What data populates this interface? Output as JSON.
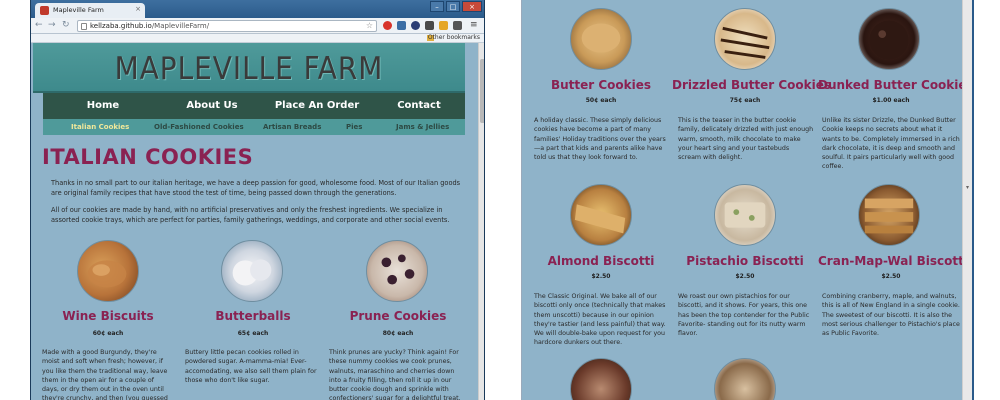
{
  "browser": {
    "tab_title": "Mapleville Farm",
    "url_host": "kellzaba.github.io",
    "url_path": "/MaplevilleFarm/",
    "bookmarks_label": "Other bookmarks"
  },
  "site": {
    "title": "MAPLEVILLE FARM",
    "nav": [
      "Home",
      "About Us",
      "Place An Order",
      "Contact"
    ],
    "subnav": [
      "Italian Cookies",
      "Old-Fashioned Cookies",
      "Artisan Breads",
      "Pies",
      "Jams & Jellies"
    ],
    "active_subnav": "Italian Cookies",
    "colors": {
      "page_bg": "#8fb3c9",
      "header": "#4f9a9a",
      "nav": "#2f5448",
      "accent": "#8a2252",
      "active_link": "#f0e89a"
    }
  },
  "page": {
    "heading": "ITALIAN COOKIES",
    "intro1": "Thanks in no small part to our italian heritage, we have a deep passion for good, wholesome food. Most of our Italian goods are original family recipes that have stood the test of time, being passed down through the generations.",
    "intro2": "All of our cookies are made by hand, with no artificial preservatives and only the freshest ingredients. We specialize in assorted cookie trays, which are perfect for parties, family gatherings, weddings, and corporate and other social events."
  },
  "products_left": [
    {
      "name": "Wine Biscuits",
      "price": "60¢ each",
      "desc": "Made with a good Burgundy, they're moist and soft when fresh; however, if you like them the traditional way, leave them in the open air for a couple of days, or dry them out in the oven until they're crunchy, and then (you guessed it) soak them in wine."
    },
    {
      "name": "Butterballs",
      "price": "65¢ each",
      "desc": "Buttery little pecan cookies rolled in powdered sugar. A-mamma-mia! Ever-accomodating, we also sell them plain for those who don't like sugar."
    },
    {
      "name": "Prune Cookies",
      "price": "80¢ each",
      "desc": "Think prunes are yucky? Think again! For these nummy cookies we cook prunes, walnuts, maraschino and cherries down into a fruity filling, then roll it up in our butter cookie dough and sprinkle with confectioners' sugar for a delightful treat."
    }
  ],
  "products_right_row1": [
    {
      "name": "Butter Cookies",
      "price": "50¢ each",
      "desc": "A holiday classic. These simply delicious cookies have become a part of many families' Holiday traditions over the years—a part that kids and parents alike have told us that they look forward to."
    },
    {
      "name": "Drizzled Butter Cookies",
      "price": "75¢ each",
      "desc": "This is the teaser in the butter cookie family, delicately drizzled with just enough warm, smooth, milk chocolate to make your heart sing and your tastebuds scream with delight."
    },
    {
      "name": "Dunked Butter Cookies",
      "price": "$1.00 each",
      "desc": "Unlike its sister Drizzle, the Dunked Butter Cookie keeps no secrets about what it wants to be. Completely immersed in a rich dark chocolate, it is deep and smooth and soulful. It pairs particularly well with good coffee."
    }
  ],
  "products_right_row2": [
    {
      "name": "Almond Biscotti",
      "price": "$2.50",
      "desc": "The Classic Original. We bake all of our biscotti only once (technically that makes them unscotti) because in our opinion they're tastier (and less painful) that way. We will double-bake upon request for you hardcore dunkers out there."
    },
    {
      "name": "Pistachio Biscotti",
      "price": "$2.50",
      "desc": "We roast our own pistachios for our biscotti, and it shows. For years, this one has been the top contender for the Public Favorite- standing out for its nutty warm flavor."
    },
    {
      "name": "Cran-Map-Wal Biscotti",
      "price": "$2.50",
      "desc": "Combining cranberry, maple, and walnuts, this is all of New England in a single cookie. The sweetest of our biscotti. It is also the most serious challenger to Pistachio's place as Public Favorite."
    }
  ]
}
